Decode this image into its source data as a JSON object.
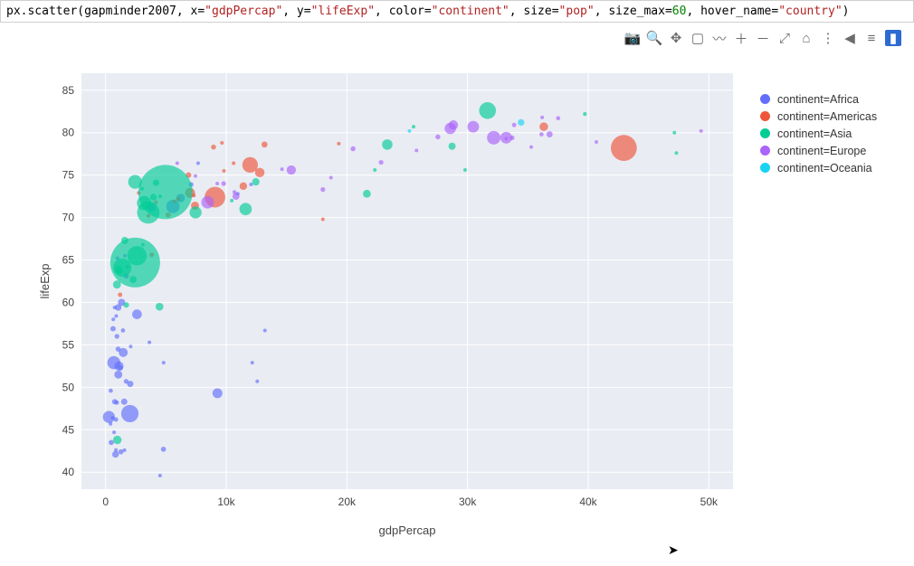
{
  "code": {
    "fn": "px.scatter",
    "args_plain": [
      "gapminder2007"
    ],
    "kwargs": [
      {
        "k": "x",
        "v": "\"gdpPercap\"",
        "t": "str"
      },
      {
        "k": "y",
        "v": "\"lifeExp\"",
        "t": "str"
      },
      {
        "k": "color",
        "v": "\"continent\"",
        "t": "str"
      },
      {
        "k": "size",
        "v": "\"pop\"",
        "t": "str"
      },
      {
        "k": "size_max",
        "v": "60",
        "t": "num"
      },
      {
        "k": "hover_name",
        "v": "\"country\"",
        "t": "str"
      }
    ],
    "trail": ")"
  },
  "toolbar_icons": [
    {
      "name": "camera-icon",
      "glyph": "📷"
    },
    {
      "name": "zoom-icon",
      "glyph": "🔍"
    },
    {
      "name": "pan-icon",
      "glyph": "✥"
    },
    {
      "name": "box-select-icon",
      "glyph": "▢"
    },
    {
      "name": "lasso-icon",
      "glyph": "〰"
    },
    {
      "name": "zoom-in-icon",
      "glyph": "＋"
    },
    {
      "name": "zoom-out-icon",
      "glyph": "－"
    },
    {
      "name": "autoscale-icon",
      "glyph": "⤢"
    },
    {
      "name": "reset-axes-icon",
      "glyph": "⌂"
    },
    {
      "name": "spike-lines-icon",
      "glyph": "⋮"
    },
    {
      "name": "hover-closest-icon",
      "glyph": "◀"
    },
    {
      "name": "hover-compare-icon",
      "glyph": "≡"
    },
    {
      "name": "plotly-logo-icon",
      "glyph": "▮",
      "active": true
    }
  ],
  "legend": [
    {
      "label": "continent=Africa",
      "color": "#636efa"
    },
    {
      "label": "continent=Americas",
      "color": "#ef553b"
    },
    {
      "label": "continent=Asia",
      "color": "#00cc96"
    },
    {
      "label": "continent=Europe",
      "color": "#ab63fa"
    },
    {
      "label": "continent=Oceania",
      "color": "#19d3f3"
    }
  ],
  "chart_data": {
    "type": "scatter",
    "xlabel": "gdpPercap",
    "ylabel": "lifeExp",
    "xlim": [
      -2000,
      52000
    ],
    "ylim": [
      38,
      87
    ],
    "x_ticks": [
      0,
      10000,
      20000,
      30000,
      40000,
      50000
    ],
    "x_tick_labels": [
      "0",
      "10k",
      "20k",
      "30k",
      "40k",
      "50k"
    ],
    "y_ticks": [
      40,
      45,
      50,
      55,
      60,
      65,
      70,
      75,
      80,
      85
    ],
    "size_max": 60,
    "series": [
      {
        "name": "Africa",
        "color": "#636efa",
        "points": [
          {
            "x": 6223,
            "y": 72.3,
            "s": 33
          },
          {
            "x": 4797,
            "y": 42.7,
            "s": 12
          },
          {
            "x": 1441,
            "y": 56.7,
            "s": 8
          },
          {
            "x": 12570,
            "y": 50.7,
            "s": 2
          },
          {
            "x": 1217,
            "y": 52.3,
            "s": 14
          },
          {
            "x": 430,
            "y": 49.6,
            "s": 8
          },
          {
            "x": 2042,
            "y": 50.4,
            "s": 18
          },
          {
            "x": 706,
            "y": 44.7,
            "s": 4
          },
          {
            "x": 1704,
            "y": 50.7,
            "s": 10
          },
          {
            "x": 986,
            "y": 65.2,
            "s": 1
          },
          {
            "x": 278,
            "y": 46.5,
            "s": 65
          },
          {
            "x": 3633,
            "y": 55.3,
            "s": 4
          },
          {
            "x": 1545,
            "y": 48.3,
            "s": 18
          },
          {
            "x": 2082,
            "y": 54.8,
            "s": 1
          },
          {
            "x": 5581,
            "y": 71.3,
            "s": 80
          },
          {
            "x": 12154,
            "y": 52.9,
            "s": 1
          },
          {
            "x": 641,
            "y": 58.0,
            "s": 5
          },
          {
            "x": 690,
            "y": 52.9,
            "s": 76
          },
          {
            "x": 13206,
            "y": 56.7,
            "s": 1
          },
          {
            "x": 753,
            "y": 59.4,
            "s": 2
          },
          {
            "x": 1327,
            "y": 60.0,
            "s": 23
          },
          {
            "x": 942,
            "y": 56.0,
            "s": 10
          },
          {
            "x": 579,
            "y": 46.4,
            "s": 2
          },
          {
            "x": 1463,
            "y": 54.1,
            "s": 36
          },
          {
            "x": 1569,
            "y": 42.6,
            "s": 2
          },
          {
            "x": 414,
            "y": 45.7,
            "s": 3
          },
          {
            "x": 12057,
            "y": 73.9,
            "s": 6
          },
          {
            "x": 1044,
            "y": 59.4,
            "s": 19
          },
          {
            "x": 759,
            "y": 48.3,
            "s": 13
          },
          {
            "x": 1043,
            "y": 54.5,
            "s": 12
          },
          {
            "x": 1803,
            "y": 64.2,
            "s": 3
          },
          {
            "x": 10957,
            "y": 72.8,
            "s": 1
          },
          {
            "x": 3820,
            "y": 71.2,
            "s": 33
          },
          {
            "x": 824,
            "y": 42.1,
            "s": 20
          },
          {
            "x": 4811,
            "y": 52.9,
            "s": 2
          },
          {
            "x": 620,
            "y": 56.9,
            "s": 13
          },
          {
            "x": 2014,
            "y": 46.9,
            "s": 135
          },
          {
            "x": 7670,
            "y": 76.4,
            "s": 1
          },
          {
            "x": 863,
            "y": 46.2,
            "s": 9
          },
          {
            "x": 1598,
            "y": 65.5,
            "s": 1
          },
          {
            "x": 1712,
            "y": 63.1,
            "s": 12
          },
          {
            "x": 862,
            "y": 42.6,
            "s": 6
          },
          {
            "x": 926,
            "y": 48.2,
            "s": 9
          },
          {
            "x": 9270,
            "y": 49.3,
            "s": 44
          },
          {
            "x": 2602,
            "y": 58.6,
            "s": 42
          },
          {
            "x": 4513,
            "y": 39.6,
            "s": 1
          },
          {
            "x": 1107,
            "y": 52.5,
            "s": 38
          },
          {
            "x": 883,
            "y": 58.4,
            "s": 6
          },
          {
            "x": 7093,
            "y": 73.9,
            "s": 10
          },
          {
            "x": 1056,
            "y": 51.5,
            "s": 29
          },
          {
            "x": 1271,
            "y": 42.4,
            "s": 12
          },
          {
            "x": 470,
            "y": 43.5,
            "s": 12
          }
        ]
      },
      {
        "name": "Americas",
        "color": "#ef553b",
        "points": [
          {
            "x": 12779,
            "y": 75.3,
            "s": 40
          },
          {
            "x": 3822,
            "y": 65.6,
            "s": 9
          },
          {
            "x": 9066,
            "y": 72.4,
            "s": 190
          },
          {
            "x": 36319,
            "y": 80.7,
            "s": 33
          },
          {
            "x": 13172,
            "y": 78.6,
            "s": 16
          },
          {
            "x": 7007,
            "y": 72.9,
            "s": 44
          },
          {
            "x": 9645,
            "y": 78.8,
            "s": 4
          },
          {
            "x": 8948,
            "y": 78.3,
            "s": 11
          },
          {
            "x": 6025,
            "y": 72.2,
            "s": 9
          },
          {
            "x": 6873,
            "y": 75.0,
            "s": 14
          },
          {
            "x": 5728,
            "y": 71.9,
            "s": 7
          },
          {
            "x": 5186,
            "y": 70.3,
            "s": 12
          },
          {
            "x": 1202,
            "y": 60.9,
            "s": 9
          },
          {
            "x": 3548,
            "y": 70.2,
            "s": 7
          },
          {
            "x": 7321,
            "y": 72.6,
            "s": 3
          },
          {
            "x": 11978,
            "y": 76.2,
            "s": 109
          },
          {
            "x": 2749,
            "y": 72.9,
            "s": 6
          },
          {
            "x": 9809,
            "y": 75.5,
            "s": 3
          },
          {
            "x": 4173,
            "y": 71.8,
            "s": 7
          },
          {
            "x": 7409,
            "y": 71.4,
            "s": 29
          },
          {
            "x": 19329,
            "y": 78.7,
            "s": 4
          },
          {
            "x": 18009,
            "y": 69.8,
            "s": 1
          },
          {
            "x": 42952,
            "y": 78.2,
            "s": 301
          },
          {
            "x": 10611,
            "y": 76.4,
            "s": 3
          },
          {
            "x": 11416,
            "y": 73.7,
            "s": 26
          }
        ]
      },
      {
        "name": "Asia",
        "color": "#00cc96",
        "points": [
          {
            "x": 975,
            "y": 43.8,
            "s": 32
          },
          {
            "x": 29796,
            "y": 75.6,
            "s": 1
          },
          {
            "x": 1391,
            "y": 64.1,
            "s": 150
          },
          {
            "x": 1714,
            "y": 59.7,
            "s": 14
          },
          {
            "x": 4959,
            "y": 73.0,
            "s": 1319
          },
          {
            "x": 39725,
            "y": 82.2,
            "s": 7
          },
          {
            "x": 2452,
            "y": 64.7,
            "s": 1110
          },
          {
            "x": 3541,
            "y": 70.6,
            "s": 224
          },
          {
            "x": 11606,
            "y": 71.0,
            "s": 69
          },
          {
            "x": 4471,
            "y": 59.5,
            "s": 27
          },
          {
            "x": 25523,
            "y": 80.7,
            "s": 6
          },
          {
            "x": 31656,
            "y": 82.6,
            "s": 127
          },
          {
            "x": 4519,
            "y": 72.5,
            "s": 6
          },
          {
            "x": 1593,
            "y": 67.3,
            "s": 23
          },
          {
            "x": 23348,
            "y": 78.6,
            "s": 49
          },
          {
            "x": 47307,
            "y": 77.6,
            "s": 3
          },
          {
            "x": 10461,
            "y": 72.0,
            "s": 4
          },
          {
            "x": 12452,
            "y": 74.2,
            "s": 25
          },
          {
            "x": 3095,
            "y": 66.8,
            "s": 3
          },
          {
            "x": 944,
            "y": 62.1,
            "s": 29
          },
          {
            "x": 1091,
            "y": 63.8,
            "s": 28
          },
          {
            "x": 22316,
            "y": 75.6,
            "s": 3
          },
          {
            "x": 2606,
            "y": 65.5,
            "s": 169
          },
          {
            "x": 3190,
            "y": 71.7,
            "s": 91
          },
          {
            "x": 21655,
            "y": 72.8,
            "s": 28
          },
          {
            "x": 47143,
            "y": 80.0,
            "s": 5
          },
          {
            "x": 3970,
            "y": 72.4,
            "s": 20
          },
          {
            "x": 4185,
            "y": 74.1,
            "s": 19
          },
          {
            "x": 28718,
            "y": 78.4,
            "s": 23
          },
          {
            "x": 7458,
            "y": 70.6,
            "s": 65
          },
          {
            "x": 2442,
            "y": 74.2,
            "s": 85
          },
          {
            "x": 3025,
            "y": 73.4,
            "s": 4
          },
          {
            "x": 2281,
            "y": 62.7,
            "s": 22
          }
        ]
      },
      {
        "name": "Europe",
        "color": "#ab63fa",
        "points": [
          {
            "x": 5937,
            "y": 76.4,
            "s": 4
          },
          {
            "x": 36126,
            "y": 79.8,
            "s": 8
          },
          {
            "x": 33693,
            "y": 79.4,
            "s": 10
          },
          {
            "x": 7446,
            "y": 74.9,
            "s": 5
          },
          {
            "x": 10681,
            "y": 73.0,
            "s": 7
          },
          {
            "x": 14619,
            "y": 75.7,
            "s": 5
          },
          {
            "x": 22833,
            "y": 76.5,
            "s": 10
          },
          {
            "x": 35278,
            "y": 78.3,
            "s": 5
          },
          {
            "x": 33207,
            "y": 79.3,
            "s": 5
          },
          {
            "x": 30470,
            "y": 80.7,
            "s": 61
          },
          {
            "x": 32170,
            "y": 79.4,
            "s": 82
          },
          {
            "x": 27538,
            "y": 79.5,
            "s": 11
          },
          {
            "x": 18009,
            "y": 73.3,
            "s": 10
          },
          {
            "x": 36181,
            "y": 81.8,
            "s": 0
          },
          {
            "x": 40676,
            "y": 78.9,
            "s": 4
          },
          {
            "x": 28570,
            "y": 80.5,
            "s": 58
          },
          {
            "x": 9254,
            "y": 74.0,
            "s": 1
          },
          {
            "x": 36798,
            "y": 79.8,
            "s": 17
          },
          {
            "x": 49357,
            "y": 80.2,
            "s": 5
          },
          {
            "x": 15390,
            "y": 75.6,
            "s": 39
          },
          {
            "x": 20510,
            "y": 78.1,
            "s": 11
          },
          {
            "x": 10808,
            "y": 72.5,
            "s": 22
          },
          {
            "x": 9787,
            "y": 74.0,
            "s": 10
          },
          {
            "x": 18678,
            "y": 74.7,
            "s": 5
          },
          {
            "x": 25768,
            "y": 77.9,
            "s": 2
          },
          {
            "x": 28821,
            "y": 80.9,
            "s": 40
          },
          {
            "x": 33860,
            "y": 80.9,
            "s": 9
          },
          {
            "x": 37506,
            "y": 81.7,
            "s": 8
          },
          {
            "x": 8458,
            "y": 71.8,
            "s": 71
          },
          {
            "x": 33203,
            "y": 79.4,
            "s": 61
          }
        ]
      },
      {
        "name": "Oceania",
        "color": "#19d3f3",
        "points": [
          {
            "x": 34435,
            "y": 81.2,
            "s": 20
          },
          {
            "x": 25185,
            "y": 80.2,
            "s": 4
          }
        ]
      }
    ]
  }
}
